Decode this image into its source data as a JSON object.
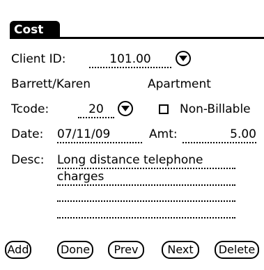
{
  "form": {
    "title": "Cost",
    "client_id_label": "Client ID:",
    "client_id_value": "101.00",
    "client_name": "Barrett/Karen",
    "client_type": "Apartment",
    "tcode_label": "Tcode:",
    "tcode_value": "20",
    "non_billable_label": "Non-Billable",
    "non_billable_checked": false,
    "date_label": "Date:",
    "date_value": "07/11/09",
    "amt_label": "Amt:",
    "amt_value": "5.00",
    "desc_label": "Desc:",
    "desc_lines": [
      "Long distance telephone",
      "charges",
      "",
      ""
    ]
  },
  "buttons": {
    "add": "Add",
    "done": "Done",
    "prev": "Prev",
    "next": "Next",
    "delete": "Delete"
  },
  "icons": {
    "dropdown": "chevron-down-icon",
    "checkbox": "checkbox-icon"
  }
}
